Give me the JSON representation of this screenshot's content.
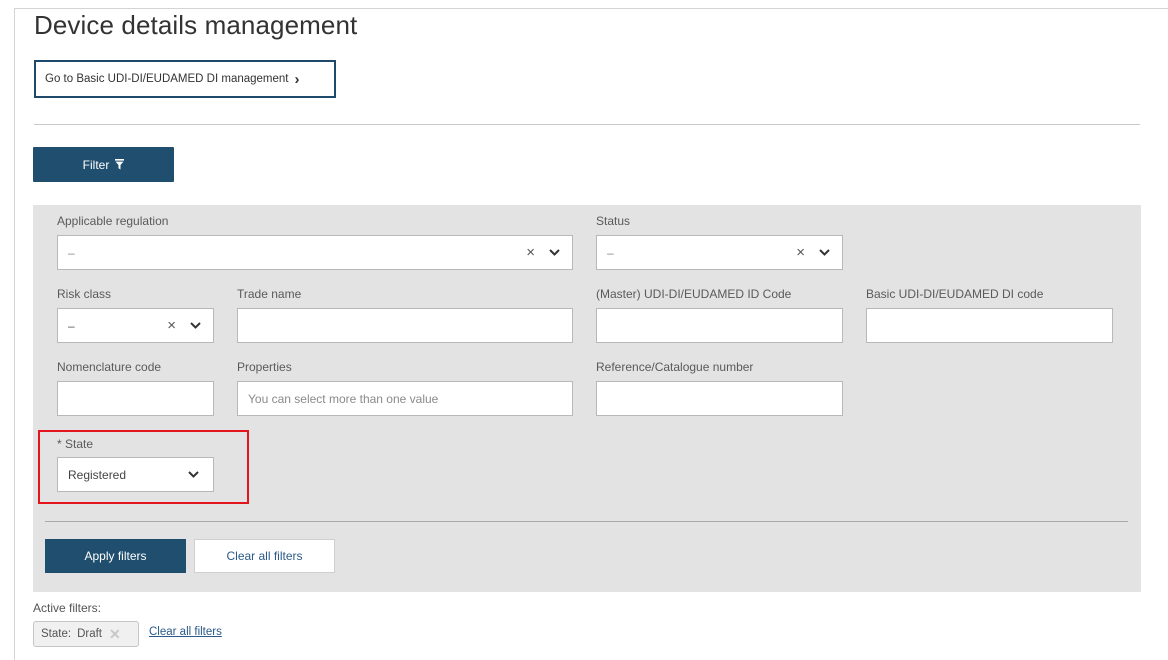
{
  "page": {
    "title": "Device details management",
    "goto_basic_label": "Go to Basic UDI-DI/EUDAMED DI management"
  },
  "filter_button": {
    "label": "Filter"
  },
  "filters": {
    "applicable_regulation": {
      "label": "Applicable regulation",
      "value": "–"
    },
    "status": {
      "label": "Status",
      "value": "–"
    },
    "risk_class": {
      "label": "Risk class",
      "value": "–"
    },
    "trade_name": {
      "label": "Trade name",
      "value": ""
    },
    "master_udi_di": {
      "label": "(Master) UDI-DI/EUDAMED ID Code",
      "value": ""
    },
    "basic_udi_di": {
      "label": "Basic UDI-DI/EUDAMED DI code",
      "value": ""
    },
    "nomenclature_code": {
      "label": "Nomenclature code",
      "value": ""
    },
    "properties": {
      "label": "Properties",
      "placeholder": "You can select more than one value"
    },
    "reference_catalogue": {
      "label": "Reference/Catalogue number",
      "value": ""
    },
    "state": {
      "label": "* State",
      "value": "Registered"
    }
  },
  "actions": {
    "apply_label": "Apply filters",
    "clear_label": "Clear all filters"
  },
  "active_filters": {
    "label": "Active filters:",
    "chips": [
      {
        "key": "State:",
        "value": "Draft"
      }
    ],
    "clear_link": "Clear all filters"
  },
  "colors": {
    "primary": "#1f4e6e",
    "panel": "#e3e3e3",
    "highlight": "#e3141b",
    "link": "#2a5a8a"
  },
  "icons": [
    "chevron-right-icon",
    "filter-icon",
    "clear-x-icon",
    "chevron-down-icon",
    "chip-remove-icon"
  ]
}
